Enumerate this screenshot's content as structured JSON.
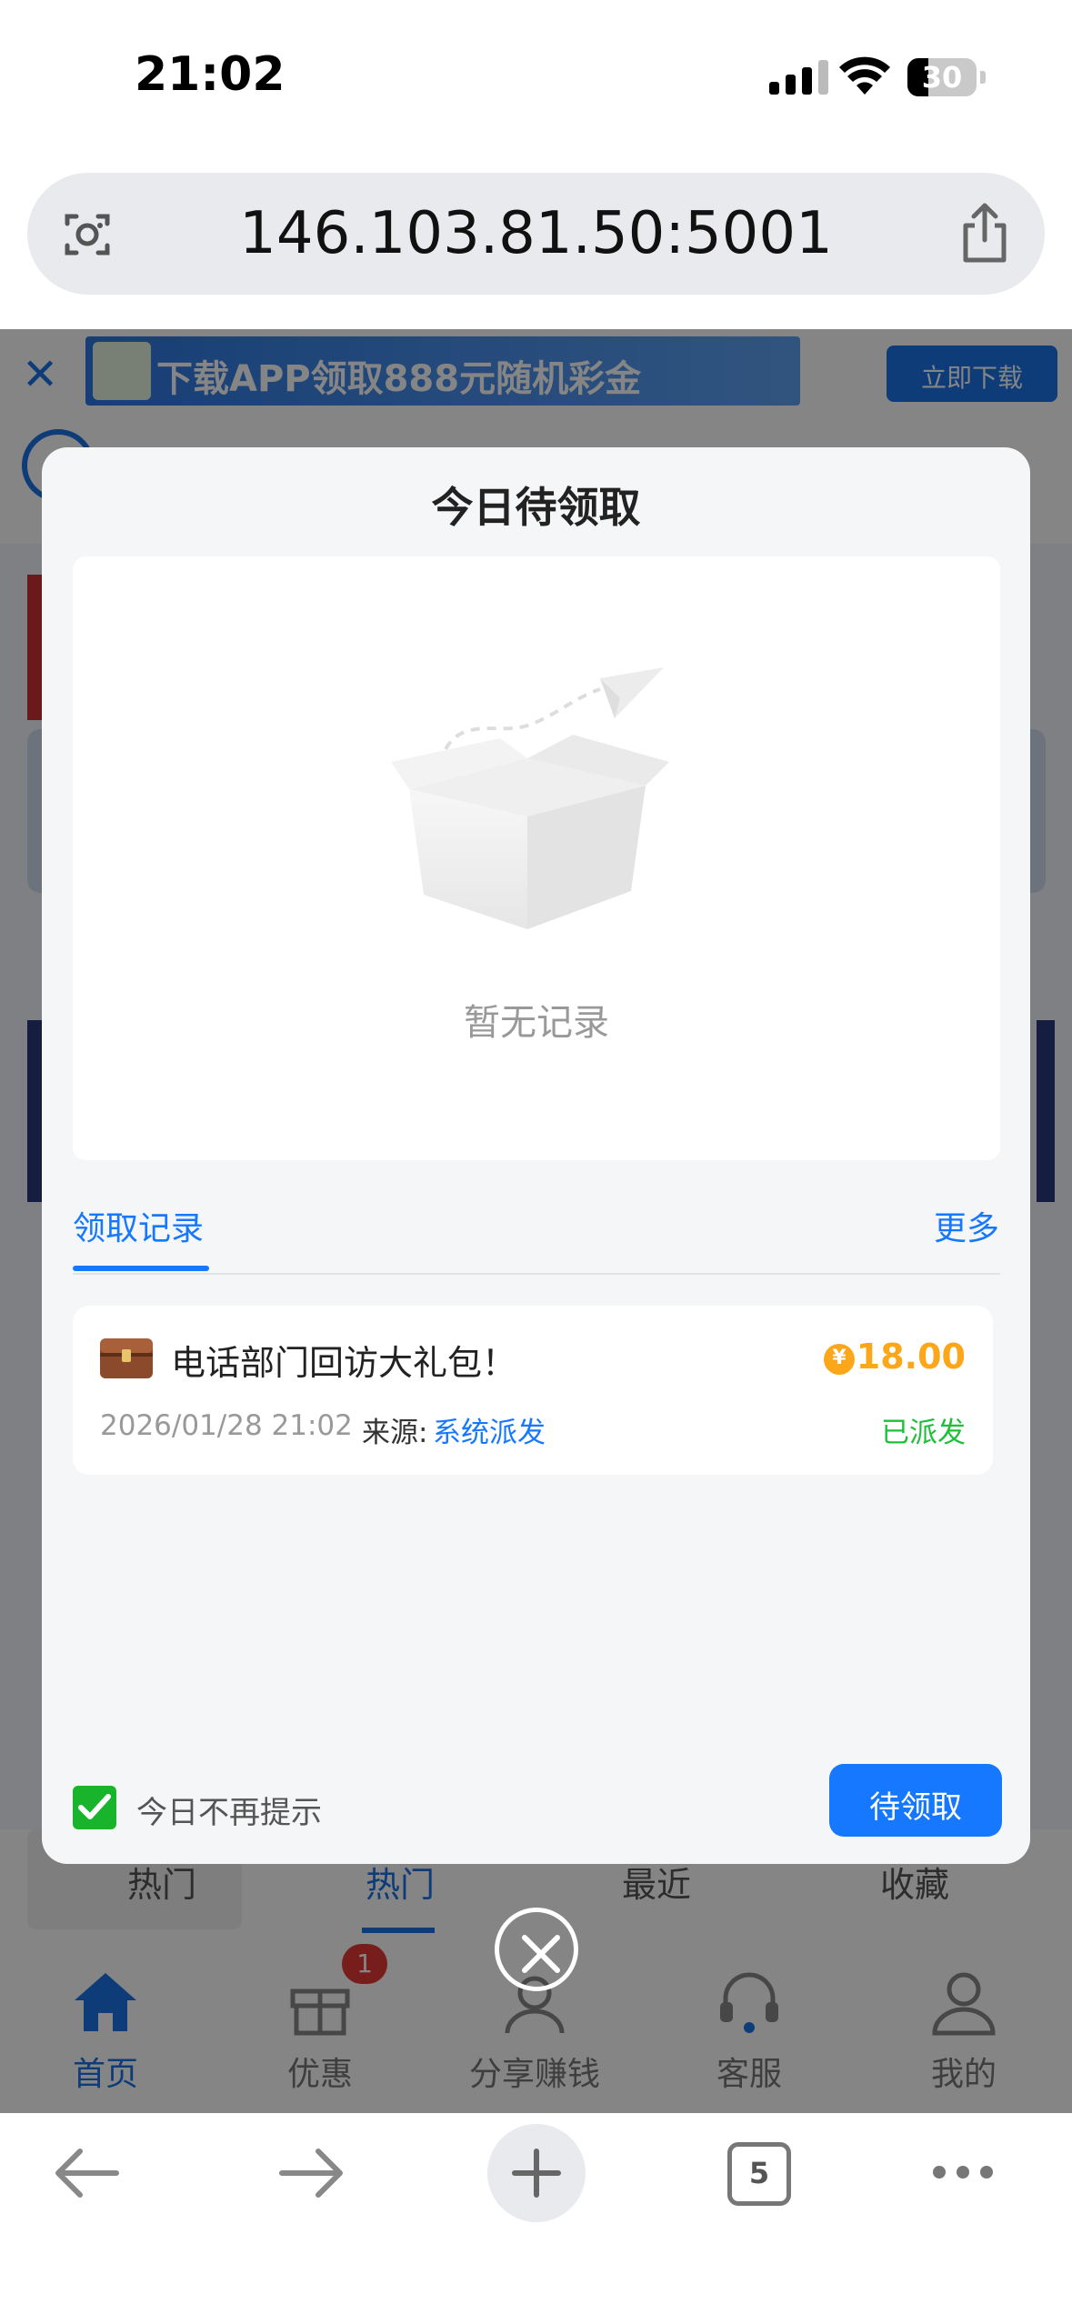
{
  "status_bar": {
    "time": "21:02",
    "battery": "30",
    "battery_level": 0.3
  },
  "browser": {
    "url": "146.103.81.50:5001",
    "tab_count": "5"
  },
  "background_page": {
    "banner_text": "下载APP领取888元随机彩金",
    "download_label": "立即下载",
    "tabs": [
      "热门",
      "热门",
      "最近",
      "收藏"
    ],
    "nav": [
      {
        "label": "首页",
        "icon": "home-icon"
      },
      {
        "label": "优惠",
        "icon": "gift-icon",
        "badge": "1"
      },
      {
        "label": "分享赚钱",
        "icon": "share-earn-icon"
      },
      {
        "label": "客服",
        "icon": "headset-icon"
      },
      {
        "label": "我的",
        "icon": "user-icon"
      }
    ]
  },
  "modal": {
    "title": "今日待领取",
    "empty_text": "暂无记录",
    "records_tab": "领取记录",
    "more": "更多",
    "record": {
      "title": "电话部门回访大礼包！",
      "currency_symbol": "¥",
      "amount": "18.00",
      "time": "2026/01/28 21:02",
      "source_label": "来源:",
      "source": "系统派发",
      "status": "已派发"
    },
    "checkbox_label": "今日不再提示",
    "checkbox_checked": true,
    "claim_button": "待领取"
  },
  "colors": {
    "accent": "#1677ff",
    "amount": "#fca619",
    "status_done": "#1fbf3b",
    "checkbox": "#18b52c"
  }
}
